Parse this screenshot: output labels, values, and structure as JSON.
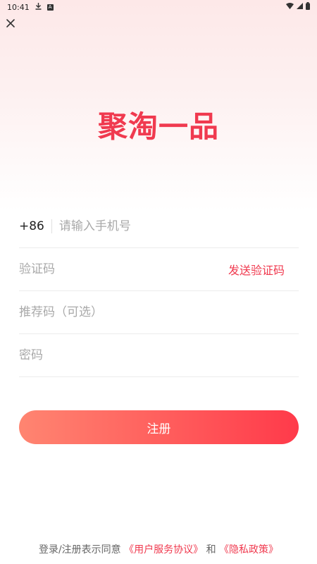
{
  "status_bar": {
    "time": "10:41",
    "icons": [
      "download-icon",
      "a-badge-icon",
      "wifi-icon",
      "signal-icon",
      "battery-icon"
    ]
  },
  "header": {
    "close_icon": "close-icon"
  },
  "app_title": "聚淘一品",
  "form": {
    "country_code": "+86",
    "phone_placeholder": "请输入手机号",
    "code_placeholder": "验证码",
    "send_code_label": "发送验证码",
    "referral_placeholder": "推荐码（可选）",
    "password_placeholder": "密码"
  },
  "register_button": "注册",
  "footer": {
    "prefix": "登录/注册表示同意",
    "user_agreement": "《用户服务协议》",
    "and": "和",
    "privacy_policy": "《隐私政策》"
  },
  "colors": {
    "accent": "#f03a4f",
    "button_gradient_start": "#ff8571",
    "button_gradient_end": "#ff3a4a"
  }
}
